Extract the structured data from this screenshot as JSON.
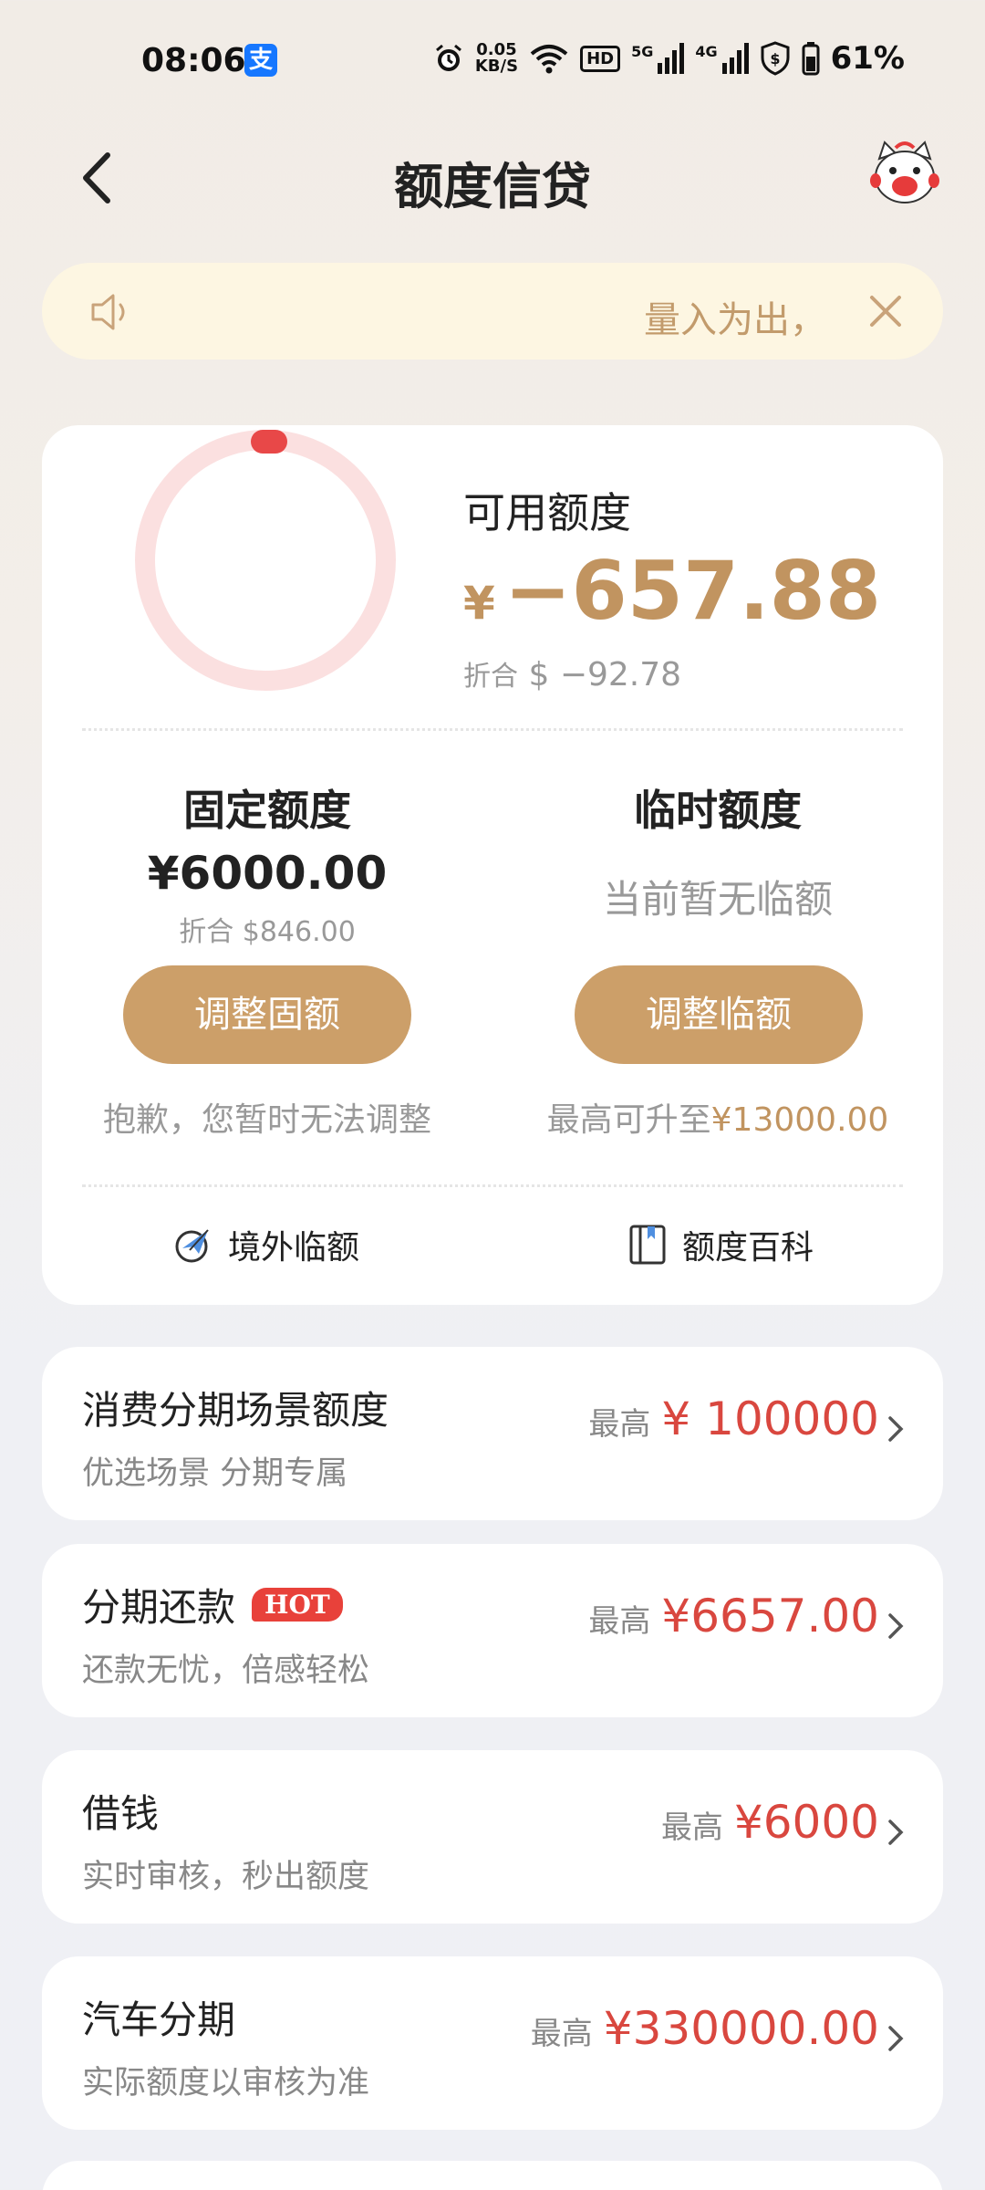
{
  "status_bar": {
    "time": "08:06",
    "app_badge": "支",
    "net_speed_value": "0.05",
    "net_speed_unit": "KB/S",
    "hd_label": "HD",
    "sim1_label": "5G",
    "sim2_label": "4G",
    "battery_percent": "61%"
  },
  "header": {
    "title": "额度信贷"
  },
  "notice": {
    "text": "量入为出，"
  },
  "available": {
    "label": "可用额度",
    "currency": "¥",
    "amount": "−657.88",
    "converted_prefix": "折合",
    "converted_currency": "$",
    "converted_amount": "−92.78",
    "ring_usage_fraction": 0.03
  },
  "fixed_quota": {
    "title": "固定额度",
    "amount": "¥6000.00",
    "converted": "折合 $846.00",
    "button_label": "调整固额",
    "note": "抱歉，您暂时无法调整"
  },
  "temp_quota": {
    "title": "临时额度",
    "status": "当前暂无临额",
    "button_label": "调整临额",
    "note_prefix": "最高可升至",
    "note_amount": "¥13000.00"
  },
  "links": {
    "overseas": "境外临额",
    "encyclopedia": "额度百科"
  },
  "rows": [
    {
      "title": "消费分期场景额度",
      "subtitle": "优选场景 分期专属",
      "max_label": "最高",
      "value": "¥ 100000"
    },
    {
      "title": "分期还款",
      "badge": "HOT",
      "subtitle": "还款无忧，倍感轻松",
      "max_label": "最高",
      "value": "¥6657.00"
    },
    {
      "title": "借钱",
      "subtitle": "实时审核，秒出额度",
      "max_label": "最高",
      "value": "¥6000"
    },
    {
      "title": "汽车分期",
      "subtitle": "实际额度以审核为准",
      "max_label": "最高",
      "value": "¥330000.00"
    }
  ],
  "colors": {
    "gold": "#cc9f69",
    "gold_text": "#c19460",
    "red_value": "#d9473f",
    "ring_track": "#fbe0e0",
    "ring_dot": "#e84848",
    "notice_bg": "#fdf6e2",
    "hot_badge": "#e8413a"
  }
}
